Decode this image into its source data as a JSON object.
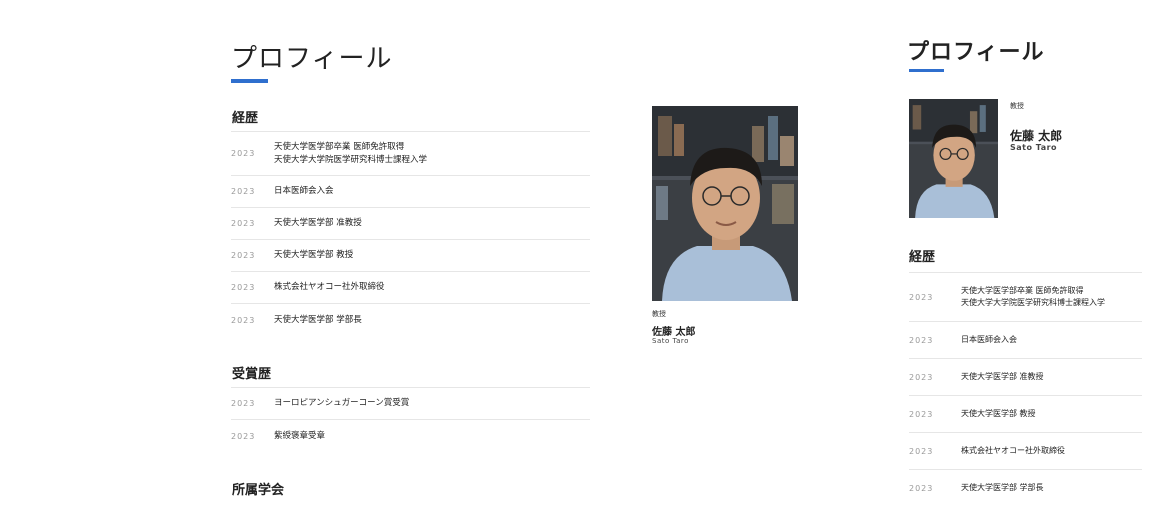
{
  "desktop": {
    "title": "プロフィール",
    "sections": {
      "career": {
        "heading": "経歴",
        "items": [
          {
            "year": "2023",
            "lines": [
              "天使大学医学部卒業 医師免許取得",
              "天使大学大学院医学研究科博士課程入学"
            ]
          },
          {
            "year": "2023",
            "lines": [
              "日本医師会入会"
            ]
          },
          {
            "year": "2023",
            "lines": [
              "天使大学医学部 准教授"
            ]
          },
          {
            "year": "2023",
            "lines": [
              "天使大学医学部 教授"
            ]
          },
          {
            "year": "2023",
            "lines": [
              "株式会社ヤオコー社外取締役"
            ]
          },
          {
            "year": "2023",
            "lines": [
              "天使大学医学部 学部長"
            ]
          }
        ]
      },
      "awards": {
        "heading": "受賞歴",
        "items": [
          {
            "year": "2023",
            "lines": [
              "ヨーロピアンシュガーコーン賞受賞"
            ]
          },
          {
            "year": "2023",
            "lines": [
              "紫綬褒章受章"
            ]
          }
        ]
      },
      "societies": {
        "heading": "所属学会"
      }
    },
    "person": {
      "role": "教授",
      "name_jp": "佐藤 太郎",
      "name_en": "Sato Taro"
    }
  },
  "mobile": {
    "title": "プロフィール",
    "person": {
      "role": "教授",
      "name_jp": "佐藤 太郎",
      "name_en": "Sato Taro"
    },
    "career": {
      "heading": "経歴",
      "items": [
        {
          "year": "2023",
          "lines": [
            "天使大学医学部卒業 医師免許取得",
            "天使大学大学院医学研究科博士課程入学"
          ]
        },
        {
          "year": "2023",
          "lines": [
            "日本医師会入会"
          ]
        },
        {
          "year": "2023",
          "lines": [
            "天使大学医学部 准教授"
          ]
        },
        {
          "year": "2023",
          "lines": [
            "天使大学医学部 教授"
          ]
        },
        {
          "year": "2023",
          "lines": [
            "株式会社ヤオコー社外取締役"
          ]
        },
        {
          "year": "2023",
          "lines": [
            "天使大学医学部 学部長"
          ]
        }
      ]
    }
  },
  "colors": {
    "accent": "#2f6fce",
    "divider": "#e6e6e6",
    "year_text": "#999999"
  }
}
